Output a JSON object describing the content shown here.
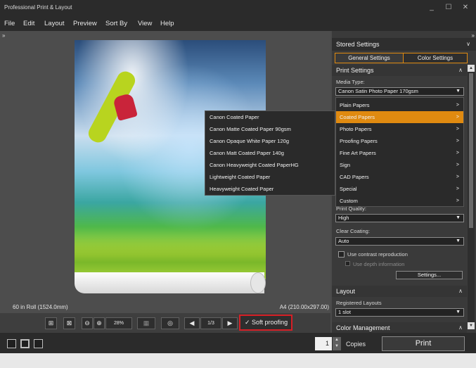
{
  "window": {
    "title": "Professional Print & Layout",
    "controls": [
      "_",
      "☐",
      "✕"
    ]
  },
  "menu": [
    "File",
    "Edit",
    "Layout",
    "Preview",
    "Sort By",
    "View",
    "Help"
  ],
  "preview": {
    "roll_label": "60 in Roll (1524.0mm)",
    "size_label": "A4 (210.00x297.00)"
  },
  "toolbar": {
    "zoom": "28%",
    "page": "1/3",
    "soft_proofing": "Soft proofing"
  },
  "status": {
    "copies_value": "1",
    "copies_label": "Copies",
    "print_label": "Print"
  },
  "panel": {
    "stored_settings": "Stored Settings",
    "tabs": [
      "General Settings",
      "Color Settings"
    ],
    "print_settings": "Print Settings",
    "media_type_label": "Media Type:",
    "media_type_value": "Canon Satin Photo Paper 170gsm",
    "categories": [
      {
        "label": "Plain Papers"
      },
      {
        "label": "Coated Papers",
        "active": true
      },
      {
        "label": "Photo Papers"
      },
      {
        "label": "Proofing Papers"
      },
      {
        "label": "Fine Art Papers"
      },
      {
        "label": "Sign"
      },
      {
        "label": "CAD Papers"
      },
      {
        "label": "Special"
      },
      {
        "label": "Custom"
      }
    ],
    "submenu": [
      "Canon Coated Paper",
      "Canon Matte Coated Paper 90gsm",
      "Canon Opaque White Paper 120g",
      "Canon Matt Coated Paper 140g",
      "Canon Heavyweight Coated PaperHG",
      "Lightweight Coated Paper",
      "Heavyweight Coated Paper"
    ],
    "print_quality_label": "Print Quality:",
    "print_quality_value": "High",
    "clear_coating_label": "Clear Coating:",
    "clear_coating_value": "Auto",
    "contrast_label": "Use contrast reproduction",
    "depth_label": "Use depth information",
    "settings_button": "Settings...",
    "layout_title": "Layout",
    "registered_layouts_label": "Registered Layouts",
    "registered_layouts_value": "1 slot",
    "color_management_title": "Color Management"
  },
  "colors": {
    "accent": "#e08a10",
    "highlight": "#d61f26"
  }
}
